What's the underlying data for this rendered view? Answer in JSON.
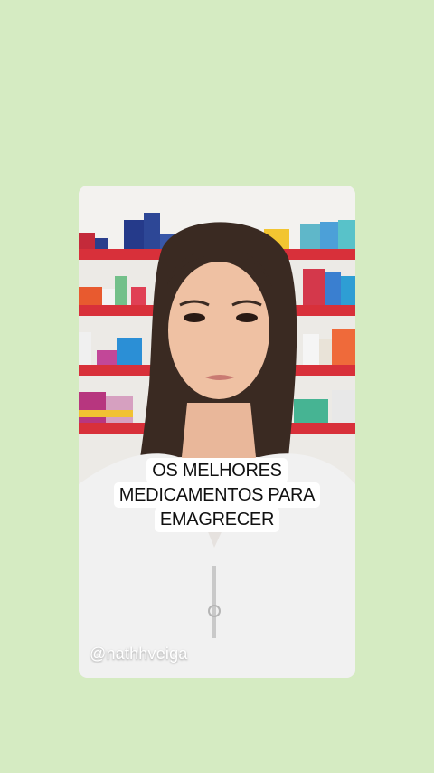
{
  "video": {
    "caption_lines": [
      "OS MELHORES",
      "MEDICAMENTOS PARA",
      "EMAGRECER"
    ],
    "creator_handle": "@nathhveiga"
  },
  "colors": {
    "page_background": "#d5ebc2",
    "shelf_red": "#d8303a",
    "caption_background": "#ffffff",
    "caption_text": "#111111"
  }
}
